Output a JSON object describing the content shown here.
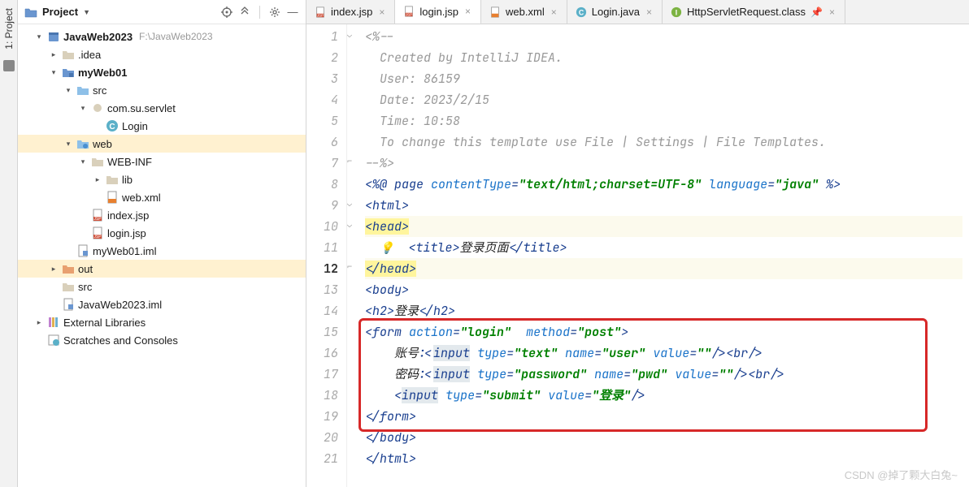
{
  "sidebar_tab": {
    "label": "1: Project"
  },
  "panel": {
    "title": "Project"
  },
  "tree": [
    {
      "depth": 0,
      "chev": "down",
      "icon": "project",
      "label": "JavaWeb2023",
      "bold": true,
      "hint": "F:\\JavaWeb2023"
    },
    {
      "depth": 1,
      "chev": "right",
      "icon": "folder",
      "label": ".idea"
    },
    {
      "depth": 1,
      "chev": "down",
      "icon": "module",
      "label": "myWeb01",
      "bold": true
    },
    {
      "depth": 2,
      "chev": "down",
      "icon": "folder-src",
      "label": "src"
    },
    {
      "depth": 3,
      "chev": "down",
      "icon": "package",
      "label": "com.su.servlet"
    },
    {
      "depth": 4,
      "chev": "",
      "icon": "class",
      "label": "Login"
    },
    {
      "depth": 2,
      "chev": "down",
      "icon": "folder-web",
      "label": "web",
      "sel": true
    },
    {
      "depth": 3,
      "chev": "down",
      "icon": "folder",
      "label": "WEB-INF"
    },
    {
      "depth": 4,
      "chev": "right",
      "icon": "folder",
      "label": "lib"
    },
    {
      "depth": 4,
      "chev": "",
      "icon": "xml",
      "label": "web.xml"
    },
    {
      "depth": 3,
      "chev": "",
      "icon": "jsp",
      "label": "index.jsp"
    },
    {
      "depth": 3,
      "chev": "",
      "icon": "jsp",
      "label": "login.jsp"
    },
    {
      "depth": 2,
      "chev": "",
      "icon": "iml",
      "label": "myWeb01.iml"
    },
    {
      "depth": 1,
      "chev": "right",
      "icon": "folder-out",
      "label": "out",
      "sel": true
    },
    {
      "depth": 1,
      "chev": "",
      "icon": "folder",
      "label": "src"
    },
    {
      "depth": 1,
      "chev": "",
      "icon": "iml",
      "label": "JavaWeb2023.iml"
    },
    {
      "depth": 0,
      "chev": "right",
      "icon": "libs",
      "label": "External Libraries"
    },
    {
      "depth": 0,
      "chev": "",
      "icon": "scratch",
      "label": "Scratches and Consoles"
    }
  ],
  "tabs": [
    {
      "icon": "jsp",
      "label": "index.jsp",
      "active": false,
      "close": true
    },
    {
      "icon": "jsp",
      "label": "login.jsp",
      "active": true,
      "close": true
    },
    {
      "icon": "xml",
      "label": "web.xml",
      "active": false,
      "close": true
    },
    {
      "icon": "class",
      "label": "Login.java",
      "active": false,
      "close": true
    },
    {
      "icon": "interface",
      "label": "HttpServletRequest.class",
      "active": false,
      "pin": true,
      "close": true
    }
  ],
  "code": {
    "current_line": 12,
    "lines": [
      {
        "n": 1,
        "html": "<span class='tok-comment'>&lt;%--</span>"
      },
      {
        "n": 2,
        "html": "<span class='tok-comment'>  Created by IntelliJ IDEA.</span>"
      },
      {
        "n": 3,
        "html": "<span class='tok-comment'>  User: 86159</span>"
      },
      {
        "n": 4,
        "html": "<span class='tok-comment'>  Date: 2023/2/15</span>"
      },
      {
        "n": 5,
        "html": "<span class='tok-comment'>  Time: 10:58</span>"
      },
      {
        "n": 6,
        "html": "<span class='tok-comment'>  To change this template use File | Settings | File Templates.</span>"
      },
      {
        "n": 7,
        "html": "<span class='tok-comment'>--%&gt;</span>"
      },
      {
        "n": 8,
        "html": "<span class='tok-key'>&lt;%@ </span><span class='tok-key'>page </span><span class='tok-attr'>contentType</span><span class='tok-key'>=</span><span class='tok-str'>\"text/html;charset=UTF-8\"</span> <span class='tok-attr'>language</span><span class='tok-key'>=</span><span class='tok-str'>\"java\"</span> <span class='tok-key'>%&gt;</span>"
      },
      {
        "n": 9,
        "html": "<span class='tok-tag'>&lt;html&gt;</span>"
      },
      {
        "n": 10,
        "html": "<span class='tok-tag hl-tag'>&lt;head&gt;</span>",
        "hl": true
      },
      {
        "n": 11,
        "html": "  <span class='bulb'>💡</span>  <span class='tok-tag'>&lt;title&gt;</span><span class='tok-text'>登录页面</span><span class='tok-tag'>&lt;/title&gt;</span>"
      },
      {
        "n": 12,
        "html": "<span class='tok-tag hl-tag'>&lt;/head&gt;</span>",
        "hl": true
      },
      {
        "n": 13,
        "html": "<span class='tok-tag'>&lt;body&gt;</span>"
      },
      {
        "n": 14,
        "html": "<span class='tok-tag'>&lt;h2&gt;</span><span class='tok-text'>登录</span><span class='tok-tag'>&lt;/h2&gt;</span>"
      },
      {
        "n": 15,
        "html": "<span class='tok-tag'>&lt;form </span><span class='tok-attr'>action</span><span class='tok-tag'>=</span><span class='tok-str'>\"login\"</span>  <span class='tok-attr'>method</span><span class='tok-tag'>=</span><span class='tok-str'>\"post\"</span><span class='tok-tag'>&gt;</span>"
      },
      {
        "n": 16,
        "html": "    <span class='tok-text'>账号:</span><span class='tok-tag'>&lt;<span class='hl-span'>input</span> </span><span class='tok-attr'>type</span><span class='tok-tag'>=</span><span class='tok-str'>\"text\"</span> <span class='tok-attr'>name</span><span class='tok-tag'>=</span><span class='tok-str'>\"user\"</span> <span class='tok-attr'>value</span><span class='tok-tag'>=</span><span class='tok-str'>\"\"</span><span class='tok-tag'>/&gt;&lt;br/&gt;</span>"
      },
      {
        "n": 17,
        "html": "    <span class='tok-text'>密码:</span><span class='tok-tag'>&lt;<span class='hl-span'>input</span> </span><span class='tok-attr'>type</span><span class='tok-tag'>=</span><span class='tok-str'>\"password\"</span> <span class='tok-attr'>name</span><span class='tok-tag'>=</span><span class='tok-str'>\"pwd\"</span> <span class='tok-attr'>value</span><span class='tok-tag'>=</span><span class='tok-str'>\"\"</span><span class='tok-tag'>/&gt;&lt;br/&gt;</span>"
      },
      {
        "n": 18,
        "html": "    <span class='tok-tag'>&lt;<span class='hl-span'>input</span> </span><span class='tok-attr'>type</span><span class='tok-tag'>=</span><span class='tok-str'>\"submit\"</span> <span class='tok-attr'>value</span><span class='tok-tag'>=</span><span class='tok-str'>\"登录\"</span><span class='tok-tag'>/&gt;</span>"
      },
      {
        "n": 19,
        "html": "<span class='tok-tag'>&lt;/form&gt;</span>"
      },
      {
        "n": 20,
        "html": "<span class='tok-tag'>&lt;/body&gt;</span>"
      },
      {
        "n": 21,
        "html": "<span class='tok-tag'>&lt;/html&gt;</span>"
      }
    ]
  },
  "watermark": "CSDN @掉了颗大白兔~"
}
